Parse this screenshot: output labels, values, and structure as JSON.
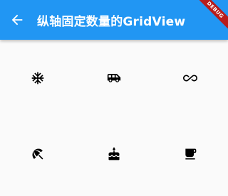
{
  "appbar": {
    "title": "纵轴固定数量的GridView",
    "back_icon": "arrow-back-icon",
    "debug_label": "DEBUG"
  },
  "colors": {
    "primary": "#2196f3",
    "background": "#fafafa",
    "icon": "#000000",
    "debug": "#b71c1c"
  },
  "grid": {
    "columns": 3,
    "items": [
      {
        "icon": "ac-unit-icon"
      },
      {
        "icon": "airport-shuttle-icon"
      },
      {
        "icon": "all-inclusive-icon"
      },
      {
        "icon": "beach-access-icon"
      },
      {
        "icon": "cake-icon"
      },
      {
        "icon": "free-breakfast-icon"
      }
    ]
  }
}
